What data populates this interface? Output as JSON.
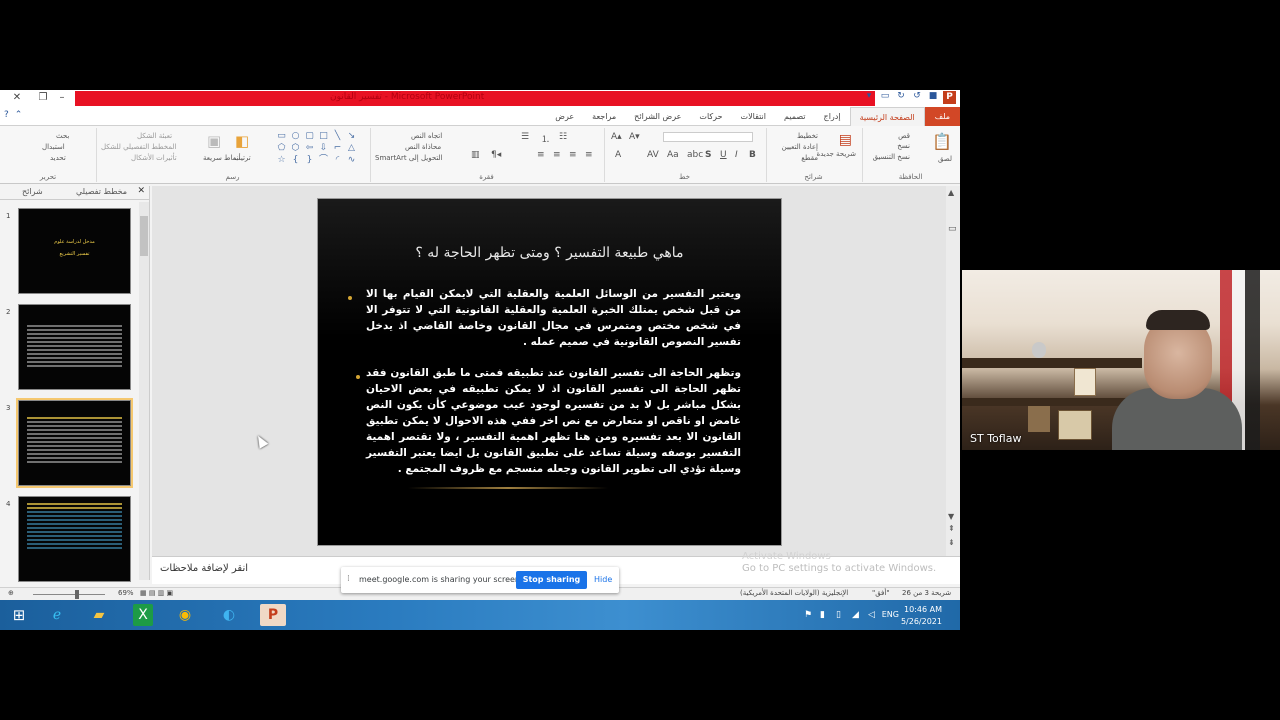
{
  "window": {
    "title": "Microsoft PowerPoint - تفسير القانون",
    "close_label": "✕",
    "restore_label": "❐",
    "minimize_label": "–"
  },
  "tabs": [
    {
      "label": "ملف",
      "kind": "file"
    },
    {
      "label": "الصفحة الرئيسية",
      "kind": "active"
    },
    {
      "label": "إدراج",
      "kind": "normal"
    },
    {
      "label": "تصميم",
      "kind": "normal"
    },
    {
      "label": "انتقالات",
      "kind": "normal"
    },
    {
      "label": "حركات",
      "kind": "normal"
    },
    {
      "label": "عرض الشرائح",
      "kind": "normal"
    },
    {
      "label": "مراجعة",
      "kind": "normal"
    },
    {
      "label": "عرض",
      "kind": "normal"
    }
  ],
  "ribbon": {
    "clipboard": {
      "label": "الحافظة",
      "paste": "لصق",
      "cut": "قص",
      "copy": "نسخ",
      "format_painter": "نسخ التنسيق"
    },
    "slides": {
      "label": "شرائح",
      "new_slide": "شريحة جديدة",
      "layout": "تخطيط",
      "reset": "إعادة التعيين",
      "section": "مقطع"
    },
    "font": {
      "label": "خط"
    },
    "paragraph": {
      "label": "فقرة",
      "text_direction": "اتجاه النص",
      "align_text": "محاذاة النص",
      "smartart": "التحويل إلى SmartArt"
    },
    "drawing": {
      "label": "رسم",
      "arrange": "ترتيب",
      "quick_styles": "أنماط سريعة",
      "shape_fill": "تعبئة الشكل",
      "shape_outline": "المخطط التفصيلي للشكل",
      "shape_effects": "تأثيرات الأشكال"
    },
    "editing": {
      "label": "تحرير",
      "find": "بحث",
      "replace": "استبدال",
      "select": "تحديد"
    }
  },
  "left_pane": {
    "tab_outline": "مخطط تفصيلي",
    "tab_slides": "شرائح",
    "close": "✕",
    "thumbnails": [
      {
        "num": "1",
        "title": "مدخل لدراسة علوم",
        "subtitle": "تفسير التشريع"
      },
      {
        "num": "2",
        "title": "",
        "subtitle": ""
      },
      {
        "num": "3",
        "title": "",
        "subtitle": ""
      },
      {
        "num": "4",
        "title": "",
        "subtitle": ""
      }
    ]
  },
  "slide": {
    "title": "ماهي طبيعة التفسير ؟ ومتى تظهر الحاجة له ؟",
    "bullets": [
      "ويعتبر التفسير من الوسائل العلمية والعقلية التي لايمكن القيام بها الا من قبل شخص يمتلك الخبرة العلمية والعقلية القانونية التي لا تتوفر الا في شخص مختص ومتمرس في مجال القانون وخاصة القاضي اذ يدخل تفسير النصوص القانونية في صميم عمله .",
      "وتظهر الحاجة الى تفسير القانون عند تطبيقه فمتى ما طبق القانون فقد تظهر الحاجة الى تفسير القانون اذ لا يمكن تطبيقه في بعض الاحيان بشكل مباشر بل لا بد من تفسيره لوجود عيب موضوعي كأن يكون النص غامض او ناقص او متعارض مع نص اخر ففي هذه الاحوال لا يمكن تطبيق القانون الا بعد تفسيره ومن هنا تظهر اهمية التفسير ، ولا تقتصر اهمية التفسير بوصفه وسيلة تساعد على تطبيق القانون بل ايضا يعتبر التفسير وسيلة تؤدي الى تطوير القانون وجعله منسجم مع ظروف المجتمع ."
    ]
  },
  "notes": {
    "placeholder": "انقر لإضافة ملاحظات",
    "activate_title": "Activate Windows",
    "activate_sub": "Go to PC settings to activate Windows."
  },
  "status": {
    "slide_count": "شريحة 3 من 26",
    "theme": "\"أفق\"",
    "language": "الإنجليزية (الولايات المتحدة الأمريكية)",
    "zoom": "69%"
  },
  "share_bar": {
    "message": "meet.google.com is sharing your screen.",
    "stop_label": "Stop sharing",
    "hide_label": "Hide"
  },
  "taskbar": {
    "lang": "ENG",
    "time": "10:46 AM",
    "date": "5/26/2021"
  },
  "camera": {
    "label": "ST Toflaw"
  }
}
